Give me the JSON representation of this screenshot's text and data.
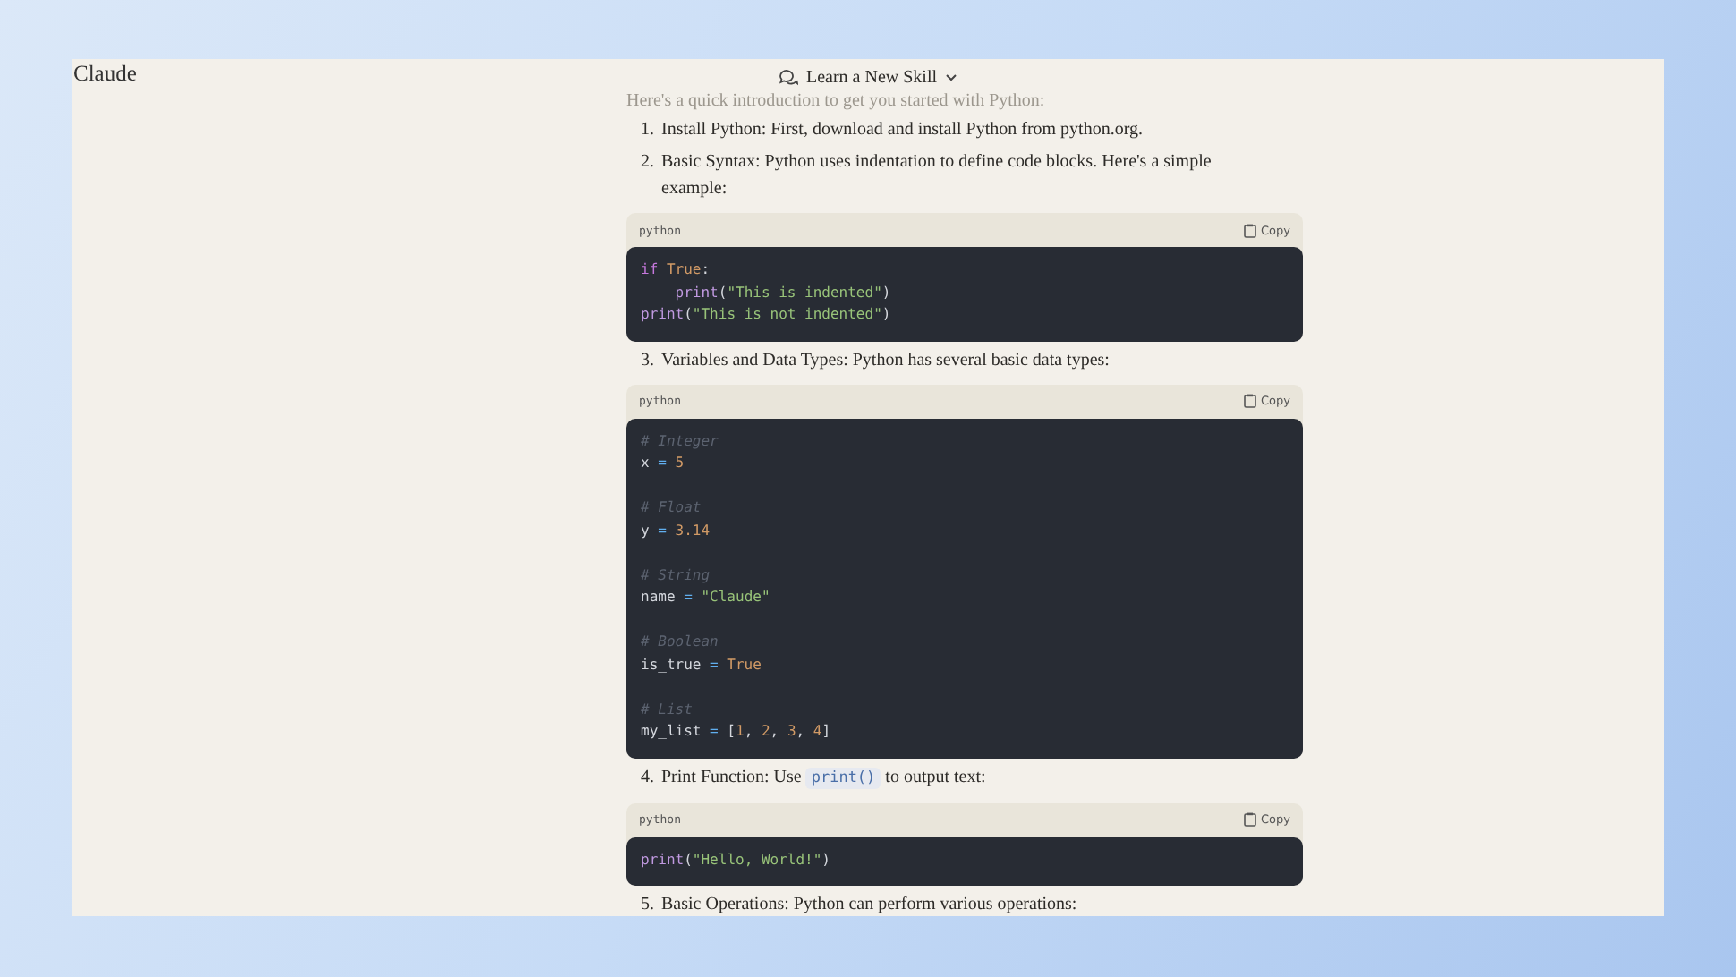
{
  "header": {
    "brand": "Claude",
    "mode_title": "Learn a New Skill"
  },
  "intro": "Here's a quick introduction to get you started with Python:",
  "content": [
    {
      "kind": "step",
      "marker": "1.",
      "parts": [
        {
          "kind": "text",
          "text": "Install Python: First, download and install Python from python.org."
        }
      ]
    },
    {
      "kind": "step",
      "marker": "2.",
      "parts": [
        {
          "kind": "text",
          "text": "Basic Syntax: Python uses indentation to define code blocks. Here's a simple example:"
        }
      ]
    },
    {
      "kind": "code",
      "language": "python",
      "copy_label": "Copy",
      "groups": [
        [
          {
            "tokens": [
              {
                "keyword": "if "
              },
              {
                "constant": "True"
              },
              {
                "plain": ":"
              }
            ]
          },
          {
            "indent": true,
            "tokens": [
              {
                "function": "print"
              },
              {
                "plain": "("
              },
              {
                "string": "\"This is indented\""
              },
              {
                "plain": ")"
              }
            ]
          },
          {
            "tokens": [
              {
                "function": "print"
              },
              {
                "plain": "("
              },
              {
                "string": "\"This is not indented\""
              },
              {
                "plain": ")"
              }
            ]
          }
        ]
      ]
    },
    {
      "kind": "step",
      "marker": "3.",
      "parts": [
        {
          "kind": "text",
          "text": "Variables and Data Types: Python has several basic data types:"
        }
      ]
    },
    {
      "kind": "code",
      "language": "python",
      "copy_label": "Copy",
      "groups": [
        [
          {
            "tokens": [
              {
                "comment": "# Integer"
              }
            ]
          },
          {
            "tokens": [
              {
                "plain": "x "
              },
              {
                "operator": "= "
              },
              {
                "constant": "5"
              }
            ]
          }
        ],
        [
          {
            "tokens": [
              {
                "comment": "# Float"
              }
            ]
          },
          {
            "tokens": [
              {
                "plain": "y "
              },
              {
                "operator": "= "
              },
              {
                "constant": "3.14"
              }
            ]
          }
        ],
        [
          {
            "tokens": [
              {
                "comment": "# String"
              }
            ]
          },
          {
            "tokens": [
              {
                "plain": "name "
              },
              {
                "operator": "= "
              },
              {
                "string": "\"Claude\""
              }
            ]
          }
        ],
        [
          {
            "tokens": [
              {
                "comment": "# Boolean"
              }
            ]
          },
          {
            "tokens": [
              {
                "plain": "is_true "
              },
              {
                "operator": "= "
              },
              {
                "constant": "True"
              }
            ]
          }
        ],
        [
          {
            "tokens": [
              {
                "comment": "# List"
              }
            ]
          },
          {
            "tokens": [
              {
                "plain": "my_list "
              },
              {
                "operator": "= "
              },
              {
                "plain": "["
              },
              {
                "constant": "1"
              },
              {
                "plain": ", "
              },
              {
                "constant": "2"
              },
              {
                "plain": ", "
              },
              {
                "constant": "3"
              },
              {
                "plain": ", "
              },
              {
                "constant": "4"
              },
              {
                "plain": "]"
              }
            ]
          }
        ]
      ]
    },
    {
      "kind": "step",
      "marker": "4.",
      "parts": [
        {
          "kind": "text",
          "text": "Print Function: Use"
        },
        {
          "kind": "code",
          "text": "print()"
        },
        {
          "kind": "text",
          "text": "to output text:"
        }
      ]
    },
    {
      "kind": "code",
      "language": "python",
      "copy_label": "Copy",
      "groups": [
        [
          {
            "tokens": [
              {
                "function": "print"
              },
              {
                "plain": "("
              },
              {
                "string": "\"Hello, World!\""
              },
              {
                "plain": ")"
              }
            ]
          }
        ]
      ]
    },
    {
      "kind": "step",
      "marker": "5.",
      "parts": [
        {
          "kind": "text",
          "text": "Basic Operations: Python can perform various operations:"
        }
      ]
    }
  ]
}
